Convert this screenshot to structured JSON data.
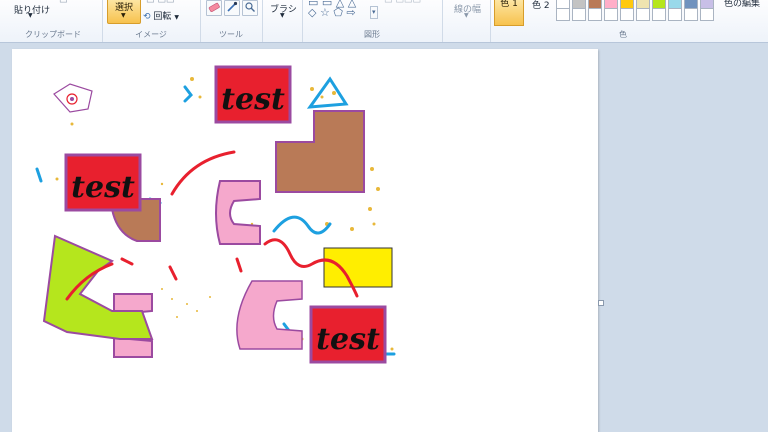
{
  "ribbon": {
    "clipboard": {
      "paste_label": "貼り付け",
      "group_label": "クリップボード"
    },
    "image": {
      "select_label": "選択",
      "rotate_label": "回転",
      "group_label": "イメージ"
    },
    "tools": {
      "group_label": "ツール"
    },
    "brushes": {
      "label": "ブラシ"
    },
    "shapes": {
      "group_label": "図形"
    },
    "size": {
      "label": "線の幅"
    },
    "colors": {
      "color1_label": "色 1",
      "color2_label": "色 2",
      "edit_label": "色の編集",
      "group_label": "色",
      "palette_row1": [
        "#ffffff",
        "#c3c3c3",
        "#b97a57",
        "#ffaec9",
        "#ffc90e",
        "#efe4b0",
        "#b5e61d",
        "#99d9ea",
        "#7092be",
        "#c8bfe7"
      ],
      "palette_row2": [
        "#ffffff",
        "#ffffff",
        "#ffffff",
        "#ffffff",
        "#ffffff",
        "#ffffff",
        "#ffffff",
        "#ffffff",
        "#ffffff",
        "#ffffff"
      ]
    }
  },
  "canvas": {
    "texts": {
      "t1": "test",
      "t2": "test",
      "t3": "test"
    },
    "colors": {
      "red": "#e8202e",
      "purple": "#9b4aa0",
      "brown": "#b97a57",
      "pink": "#f5a8cc",
      "lime": "#b5e61d",
      "yellow": "#ffee00",
      "blue": "#1da0e0",
      "gold": "#e8b83a"
    }
  }
}
